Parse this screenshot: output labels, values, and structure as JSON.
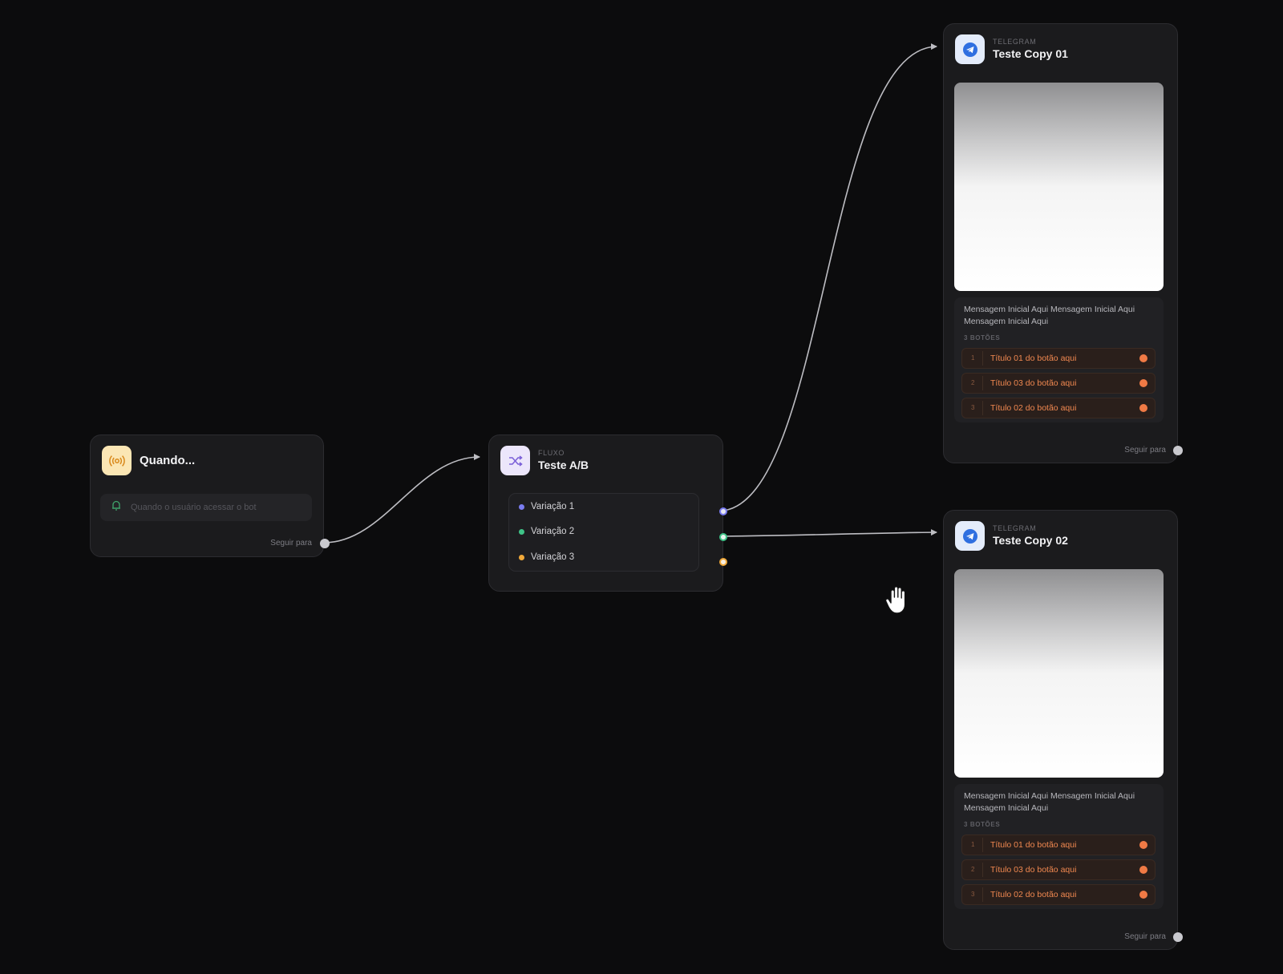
{
  "colors": {
    "background": "#0c0c0d",
    "edge": "#bdbdc2",
    "variation_1": "#7a7cf0",
    "variation_2": "#3fc488",
    "variation_3": "#f0a93a",
    "telegram": "#2f6fe0",
    "button_accent": "#f07a45"
  },
  "trigger_node": {
    "title": "Quando...",
    "icon": "broadcast-icon",
    "field_icon": "bell-icon",
    "field_text": "Quando o usuário acessar o bot",
    "follow_label": "Seguir para"
  },
  "ab_node": {
    "kind": "FLUXO",
    "title": "Teste A/B",
    "icon": "shuffle-icon",
    "variations": [
      {
        "label": "Variação 1"
      },
      {
        "label": "Variação 2"
      },
      {
        "label": "Variação 3"
      }
    ]
  },
  "telegram_nodes": [
    {
      "kind": "TELEGRAM",
      "title": "Teste Copy 01",
      "icon": "telegram-icon",
      "message": "Mensagem Inicial Aqui Mensagem Inicial Aqui Mensagem Inicial Aqui",
      "buttons_count": "3 BOTÕES",
      "buttons": [
        {
          "num": "1",
          "label": "Título 01 do botão aqui"
        },
        {
          "num": "2",
          "label": "Título 03 do botão aqui"
        },
        {
          "num": "3",
          "label": "Título 02 do botão aqui"
        }
      ],
      "follow_label": "Seguir para"
    },
    {
      "kind": "TELEGRAM",
      "title": "Teste Copy 02",
      "icon": "telegram-icon",
      "message": "Mensagem Inicial Aqui Mensagem Inicial Aqui Mensagem Inicial Aqui",
      "buttons_count": "3 BOTÕES",
      "buttons": [
        {
          "num": "1",
          "label": "Título 01 do botão aqui"
        },
        {
          "num": "2",
          "label": "Título 03 do botão aqui"
        },
        {
          "num": "3",
          "label": "Título 02 do botão aqui"
        }
      ],
      "follow_label": "Seguir para"
    }
  ],
  "cursor": "grab-hand-icon"
}
